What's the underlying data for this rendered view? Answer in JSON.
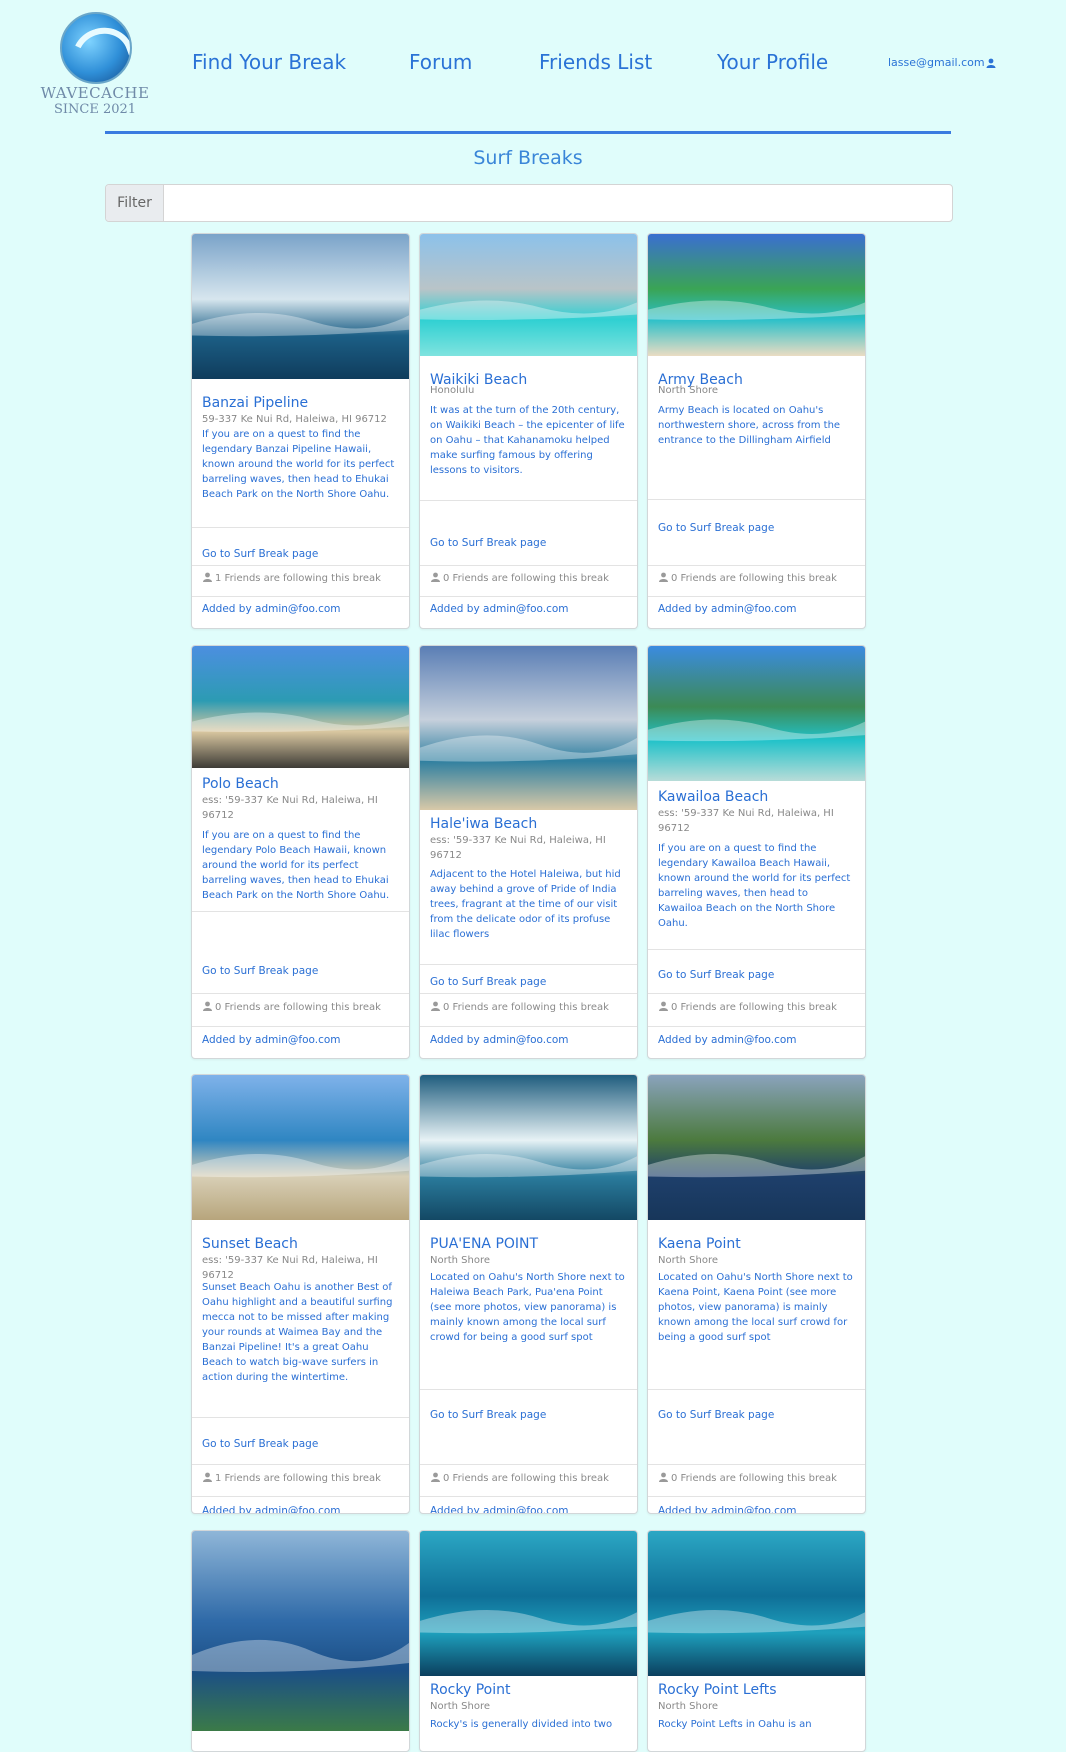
{
  "logo": {
    "brand": "WAVECACHE",
    "since": "SINCE 2021",
    "icon": "wave-logo-icon"
  },
  "nav": [
    "Find Your Break",
    "Forum",
    "Friends List",
    "Your Profile"
  ],
  "user": {
    "email": "lasse@gmail.com",
    "icon": "user-icon"
  },
  "page": {
    "title": "Surf Breaks"
  },
  "filter": {
    "label": "Filter",
    "value": ""
  },
  "cards": [
    {
      "name": "Banzai Pipeline",
      "location": "59-337 Ke Nui Rd, Haleiwa, HI 96712",
      "description": "If you are on a quest to find the legendary Banzai Pipeline Hawaii, known around the world for its perfect barreling waves, then head to Ehukai Beach Park on the North Shore Oahu.",
      "link": "Go to Surf Break page",
      "friends": "1 Friends are following this break",
      "added": "Added by admin@foo.com",
      "colors": [
        "#7aa3c9",
        "#d7e6ee",
        "#1c5f86",
        "#0f3c5c"
      ]
    },
    {
      "name": "Waikiki Beach",
      "location": "Honolulu",
      "description": "It was at the turn of the 20th century, on Waikiki Beach – the epicenter of life on Oahu – that Kahanamoku helped make surfing famous by offering lessons to visitors.",
      "link": "Go to Surf Break page",
      "friends": "0 Friends are following this break",
      "added": "Added by admin@foo.com",
      "colors": [
        "#8cc1ea",
        "#b9c4c8",
        "#2fd0d2",
        "#7fe3df"
      ]
    },
    {
      "name": "Army Beach",
      "location": "North Shore",
      "description": "Army Beach is located on Oahu's northwestern shore, across from the entrance to the Dillingham Airfield",
      "link": "Go to Surf Break page",
      "friends": "0 Friends are following this break",
      "added": "Added by admin@foo.com",
      "colors": [
        "#3a6fd0",
        "#3aa455",
        "#2bc0c9",
        "#eadcc3"
      ]
    },
    {
      "name": "Polo Beach",
      "location": "ess: '59-337 Ke Nui Rd, Haleiwa, HI 96712",
      "description": "If you are on a quest to find the legendary Polo Beach Hawaii, known around the world for its perfect barreling waves, then head to Ehukai Beach Park on the North Shore Oahu.",
      "link": "Go to Surf Break page",
      "friends": "0 Friends are following this break",
      "added": "Added by admin@foo.com",
      "colors": [
        "#4c8fe0",
        "#2c9bb3",
        "#d9c7a0",
        "#3d3b36"
      ]
    },
    {
      "name": "Hale'iwa Beach",
      "location": "ess: '59-337 Ke Nui Rd, Haleiwa, HI 96712",
      "description": "Adjacent to the Hotel Haleiwa, but hid away behind a grove of Pride of India trees, fragrant at the time of our visit from the delicate odor of its profuse lilac flowers",
      "link": "Go to Surf Break page",
      "friends": "0 Friends are following this break",
      "added": "Added by admin@foo.com",
      "colors": [
        "#5a7eb5",
        "#c6d0dc",
        "#2f7fa0",
        "#d8c9a8"
      ]
    },
    {
      "name": "Kawailoa Beach",
      "location": "ess: '59-337 Ke Nui Rd, Haleiwa, HI 96712",
      "description": "If you are on a quest to find the legendary Kawailoa Beach Hawaii, known around the world for its perfect barreling waves, then head to Kawailoa Beach on the North Shore Oahu.",
      "link": "Go to Surf Break page",
      "friends": "0 Friends are following this break",
      "added": "Added by admin@foo.com",
      "colors": [
        "#3b8be0",
        "#3c8a55",
        "#22c2c9",
        "#b8dcd8"
      ]
    },
    {
      "name": "Sunset Beach",
      "location": "ess: '59-337 Ke Nui Rd, Haleiwa, HI 96712",
      "description": "Sunset Beach Oahu is another Best of Oahu highlight and a beautiful surfing mecca not to be missed after making your rounds at Waimea Bay and the Banzai Pipeline! It's a great Oahu Beach to watch big-wave surfers in action during the wintertime.",
      "link": "Go to Surf Break page",
      "friends": "1 Friends are following this break",
      "added": "Added by admin@foo.com",
      "colors": [
        "#7fb2ea",
        "#2f86c2",
        "#d8cfb6",
        "#b7a57c"
      ]
    },
    {
      "name": "PUA'ENA POINT",
      "location": "North Shore",
      "description": "Located on Oahu's North Shore next to Haleiwa Beach Park, Pua'ena Point (see more photos, view panorama) is mainly known among the local surf crowd for being a good surf spot",
      "link": "Go to Surf Break page",
      "friends": "0 Friends are following this break",
      "added": "Added by admin@foo.com",
      "colors": [
        "#1f5d7e",
        "#e7f2f5",
        "#2a7b9c",
        "#134864"
      ]
    },
    {
      "name": "Kaena Point",
      "location": "North Shore",
      "description": "Located on Oahu's North Shore next to Kaena Point, Kaena Point (see more photos, view panorama) is mainly known among the local surf crowd for being a good surf spot",
      "link": "Go to Surf Break page",
      "friends": "0 Friends are following this break",
      "added": "Added by admin@foo.com",
      "colors": [
        "#8aa3bd",
        "#4c7a3e",
        "#1e3f6b",
        "#17365a"
      ]
    },
    {
      "name": "",
      "location": "",
      "description": "",
      "link": "",
      "friends": "",
      "added": "",
      "colors": [
        "#8fb6d8",
        "#2f6aa8",
        "#1b4f86",
        "#3b7a48"
      ]
    },
    {
      "name": "Rocky Point",
      "location": "North Shore",
      "description": "Rocky's is generally divided into two",
      "link": "",
      "friends": "",
      "added": "",
      "colors": [
        "#2ba7c4",
        "#0f6f97",
        "#1ea0bd",
        "#0b3f5e"
      ]
    },
    {
      "name": "Rocky Point Lefts",
      "location": "North Shore",
      "description": "Rocky Point Lefts in Oahu is an",
      "link": "",
      "friends": "",
      "added": "",
      "colors": [
        "#2ba7c4",
        "#0f6f97",
        "#1ea0bd",
        "#0b3f5e"
      ]
    }
  ]
}
